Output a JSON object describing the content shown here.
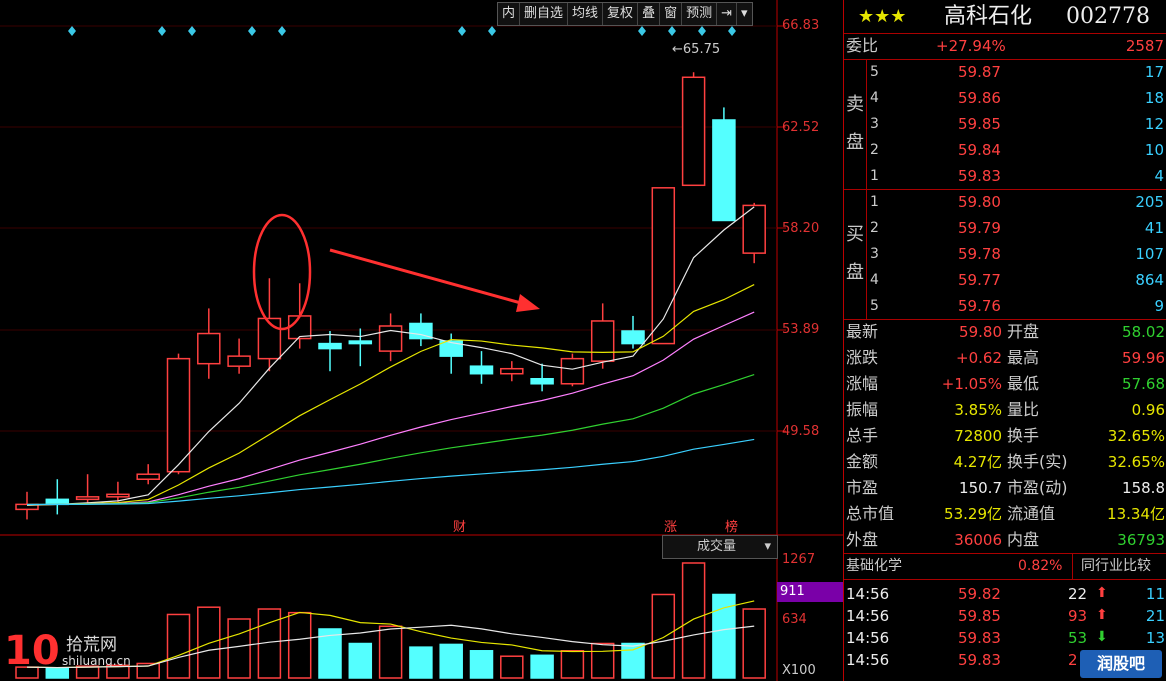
{
  "toolbar": {
    "items": [
      "内",
      "删自选",
      "均线",
      "复权",
      "叠",
      "窗",
      "预测"
    ],
    "menu_icon": "arrow-right-bar-icon",
    "dropdown_icon": "triangle-down-icon"
  },
  "price_axis": [
    "66.83",
    "62.52",
    "58.20",
    "53.89",
    "49.58"
  ],
  "volume_axis": [
    "1267",
    "911",
    "634",
    "X100"
  ],
  "annotations": {
    "high_label": "65.75",
    "event_cai": "财",
    "event_zhang": "涨",
    "event_bang": "榜"
  },
  "volume_selector": "成交量",
  "colors": {
    "up": "#ff4040",
    "down": "#54ffff",
    "ma5": "#e8e8e8",
    "ma10": "#e6e600",
    "ma20": "#ff80ff",
    "ma30": "#30d030",
    "ma60": "#3ad0ff"
  },
  "chart_data": {
    "type": "candlestick",
    "y_range": [
      47.5,
      67.8
    ],
    "candles": [
      {
        "o": 48.6,
        "c": 48.4,
        "h": 49.1,
        "l": 48.0,
        "dir": "up"
      },
      {
        "o": 48.6,
        "c": 48.8,
        "h": 49.6,
        "l": 48.2,
        "dir": "down"
      },
      {
        "o": 48.8,
        "c": 48.9,
        "h": 49.8,
        "l": 48.6,
        "dir": "up"
      },
      {
        "o": 48.9,
        "c": 49.0,
        "h": 49.5,
        "l": 48.7,
        "dir": "up"
      },
      {
        "o": 49.6,
        "c": 49.8,
        "h": 50.2,
        "l": 49.4,
        "dir": "up"
      },
      {
        "o": 49.9,
        "c": 54.4,
        "h": 54.6,
        "l": 49.8,
        "dir": "up"
      },
      {
        "o": 54.2,
        "c": 55.4,
        "h": 56.4,
        "l": 53.6,
        "dir": "up"
      },
      {
        "o": 54.1,
        "c": 54.5,
        "h": 55.2,
        "l": 53.8,
        "dir": "up"
      },
      {
        "o": 54.4,
        "c": 56.0,
        "h": 57.6,
        "l": 53.9,
        "dir": "up"
      },
      {
        "o": 55.2,
        "c": 56.1,
        "h": 57.4,
        "l": 54.8,
        "dir": "up"
      },
      {
        "o": 55.0,
        "c": 54.8,
        "h": 55.5,
        "l": 53.9,
        "dir": "down"
      },
      {
        "o": 55.1,
        "c": 55.0,
        "h": 55.6,
        "l": 54.1,
        "dir": "down"
      },
      {
        "o": 54.7,
        "c": 55.7,
        "h": 56.2,
        "l": 54.3,
        "dir": "up"
      },
      {
        "o": 55.8,
        "c": 55.2,
        "h": 56.2,
        "l": 54.9,
        "dir": "down"
      },
      {
        "o": 55.1,
        "c": 54.5,
        "h": 55.4,
        "l": 53.8,
        "dir": "down"
      },
      {
        "o": 54.1,
        "c": 53.8,
        "h": 54.7,
        "l": 53.4,
        "dir": "down"
      },
      {
        "o": 54.0,
        "c": 53.8,
        "h": 54.3,
        "l": 53.5,
        "dir": "up"
      },
      {
        "o": 53.6,
        "c": 53.4,
        "h": 54.2,
        "l": 53.1,
        "dir": "down"
      },
      {
        "o": 53.4,
        "c": 54.4,
        "h": 54.6,
        "l": 53.3,
        "dir": "up"
      },
      {
        "o": 54.3,
        "c": 55.9,
        "h": 56.6,
        "l": 54.0,
        "dir": "up"
      },
      {
        "o": 55.5,
        "c": 55.0,
        "h": 56.1,
        "l": 54.8,
        "dir": "down"
      },
      {
        "o": 55.0,
        "c": 61.2,
        "h": 61.2,
        "l": 55.0,
        "dir": "up"
      },
      {
        "o": 61.3,
        "c": 65.6,
        "h": 65.8,
        "l": 61.3,
        "dir": "up"
      },
      {
        "o": 63.9,
        "c": 59.9,
        "h": 64.4,
        "l": 59.9,
        "dir": "down"
      },
      {
        "o": 58.6,
        "c": 60.5,
        "h": 60.6,
        "l": 58.2,
        "dir": "up"
      }
    ],
    "volume": [
      {
        "v": 120,
        "dir": "up"
      },
      {
        "v": 110,
        "dir": "down"
      },
      {
        "v": 130,
        "dir": "up"
      },
      {
        "v": 140,
        "dir": "up"
      },
      {
        "v": 160,
        "dir": "up"
      },
      {
        "v": 700,
        "dir": "up"
      },
      {
        "v": 780,
        "dir": "up"
      },
      {
        "v": 650,
        "dir": "up"
      },
      {
        "v": 760,
        "dir": "up"
      },
      {
        "v": 720,
        "dir": "up"
      },
      {
        "v": 540,
        "dir": "down"
      },
      {
        "v": 380,
        "dir": "down"
      },
      {
        "v": 570,
        "dir": "up"
      },
      {
        "v": 340,
        "dir": "down"
      },
      {
        "v": 370,
        "dir": "down"
      },
      {
        "v": 300,
        "dir": "down"
      },
      {
        "v": 240,
        "dir": "up"
      },
      {
        "v": 250,
        "dir": "down"
      },
      {
        "v": 300,
        "dir": "up"
      },
      {
        "v": 380,
        "dir": "up"
      },
      {
        "v": 380,
        "dir": "down"
      },
      {
        "v": 920,
        "dir": "up"
      },
      {
        "v": 1267,
        "dir": "up"
      },
      {
        "v": 920,
        "dir": "down"
      },
      {
        "v": 760,
        "dir": "up"
      }
    ],
    "vol_range": [
      0,
      1300
    ]
  },
  "panel": {
    "stars": "★★★",
    "name": "高科石化",
    "code": "002778",
    "weibi": {
      "label": "委比",
      "pct": "+27.94%",
      "val": "2587"
    },
    "sell_label_1": "卖",
    "sell_label_2": "盘",
    "buy_label_1": "买",
    "buy_label_2": "盘",
    "asks": [
      {
        "n": "5",
        "p": "59.87",
        "v": "17"
      },
      {
        "n": "4",
        "p": "59.86",
        "v": "18"
      },
      {
        "n": "3",
        "p": "59.85",
        "v": "12"
      },
      {
        "n": "2",
        "p": "59.84",
        "v": "10"
      },
      {
        "n": "1",
        "p": "59.83",
        "v": "4"
      }
    ],
    "bids": [
      {
        "n": "1",
        "p": "59.80",
        "v": "205"
      },
      {
        "n": "2",
        "p": "59.79",
        "v": "41"
      },
      {
        "n": "3",
        "p": "59.78",
        "v": "107"
      },
      {
        "n": "4",
        "p": "59.77",
        "v": "864"
      },
      {
        "n": "5",
        "p": "59.76",
        "v": "9"
      }
    ],
    "stats": [
      {
        "l1": "最新",
        "v1": "59.80",
        "l2": "开盘",
        "v2": "58.02",
        "c1": "red",
        "c2": "green"
      },
      {
        "l1": "涨跌",
        "v1": "+0.62",
        "l2": "最高",
        "v2": "59.96",
        "c1": "red",
        "c2": "red"
      },
      {
        "l1": "涨幅",
        "v1": "+1.05%",
        "l2": "最低",
        "v2": "57.68",
        "c1": "red",
        "c2": "green"
      },
      {
        "l1": "振幅",
        "v1": "3.85%",
        "l2": "量比",
        "v2": "0.96",
        "c1": "yellow",
        "c2": "yellow"
      },
      {
        "l1": "总手",
        "v1": "72800",
        "l2": "换手",
        "v2": "32.65%",
        "c1": "yellow",
        "c2": "yellow"
      },
      {
        "l1": "金额",
        "v1": "4.27亿",
        "l2": "换手(实)",
        "v2": "32.65%",
        "c1": "yellow",
        "c2": "yellow"
      },
      {
        "l1": "市盈",
        "v1": "150.7",
        "l2": "市盈(动)",
        "v2": "158.8",
        "c1": "white",
        "c2": "white"
      },
      {
        "l1": "总市值",
        "v1": "53.29亿",
        "l2": "流通值",
        "v2": "13.34亿",
        "c1": "yellow",
        "c2": "yellow"
      },
      {
        "l1": "外盘",
        "v1": "36006",
        "l2": "内盘",
        "v2": "36793",
        "c1": "red",
        "c2": "green"
      }
    ],
    "sector": {
      "name": "基础化学",
      "pct": "0.82%",
      "compare": "同行业比较"
    },
    "ticks": [
      {
        "t": "14:56",
        "p": "59.82",
        "v": "22",
        "arrow": "up",
        "extra": "11",
        "vc": "white"
      },
      {
        "t": "14:56",
        "p": "59.85",
        "v": "93",
        "arrow": "up",
        "extra": "21",
        "vc": "red"
      },
      {
        "t": "14:56",
        "p": "59.83",
        "v": "53",
        "arrow": "down",
        "extra": "13",
        "vc": "green"
      },
      {
        "t": "14:56",
        "p": "59.83",
        "v": "2",
        "arrow": "down",
        "extra": "",
        "vc": "red"
      }
    ]
  },
  "logos": {
    "left_big": "10",
    "left_cn": "拾荒网",
    "left_url": "shiluang.cn",
    "right": "润股吧"
  }
}
